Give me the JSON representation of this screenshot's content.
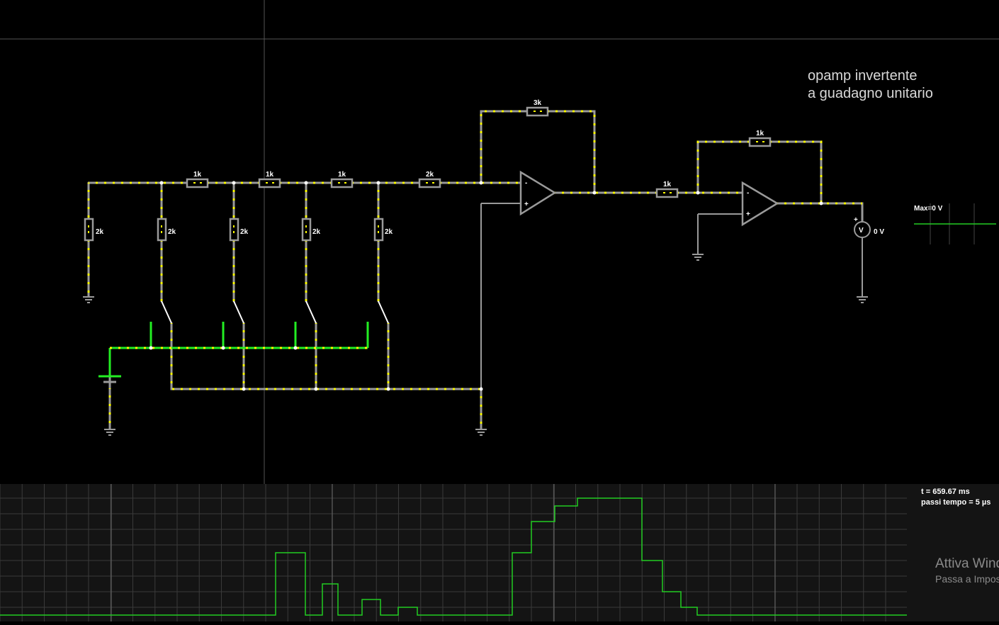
{
  "annotation": {
    "line1": "opamp invertente",
    "line2": "a guadagno unitario"
  },
  "resistors": {
    "ladder_r1": "2k",
    "ladder_r2": "2k",
    "ladder_r3": "2k",
    "ladder_r4": "2k",
    "ladder_r5": "2k",
    "series_r1": "1k",
    "series_r2": "1k",
    "series_r3": "1k",
    "series_r4": "2k",
    "feedback_r1": "3k",
    "input_r2": "1k",
    "feedback_r2": "1k"
  },
  "opamp": {
    "minus": "-",
    "plus": "+"
  },
  "voltmeter": {
    "symbol": "V",
    "plus": "+",
    "reading": "0 V"
  },
  "side_scope": {
    "max_label": "Max=0 V"
  },
  "scope": {
    "time_label": "t = 659.67 ms",
    "step_label": "passi tempo = 5 µs",
    "trace_color": "#22cc22"
  },
  "watermark": {
    "line1": "Attiva Windows",
    "line2": "Passa a Impostazioni"
  },
  "colors": {
    "wire_active": "#ffff00",
    "wire_idle": "#9a9a9a",
    "source_green": "#22ee22"
  }
}
